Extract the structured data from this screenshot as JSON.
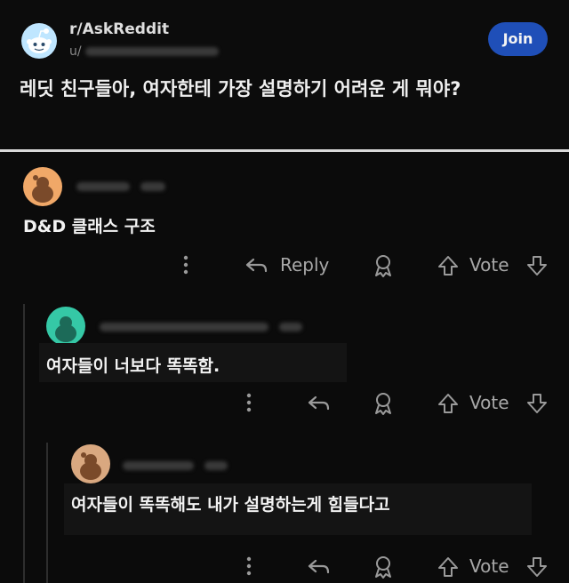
{
  "post": {
    "subreddit": "r/AskReddit",
    "user_prefix": "u/",
    "join_label": "Join",
    "title": "레딧 친구들아, 여자한테 가장 설명하기 어려운 게 뭐야?"
  },
  "comments": [
    {
      "text": "D&D 클래스 구조",
      "reply_label": "Reply",
      "vote_label": "Vote"
    },
    {
      "text": "여자들이 너보다 똑똑함.",
      "vote_label": "Vote"
    },
    {
      "text": "여자들이 똑똑해도 내가 설명하는게 힘들다고",
      "vote_label": "Vote"
    }
  ],
  "colors": {
    "join_button": "#1f4fb8",
    "avatar_1": "#f0a868",
    "avatar_2": "#35c8a6",
    "avatar_3": "#d9a880"
  }
}
